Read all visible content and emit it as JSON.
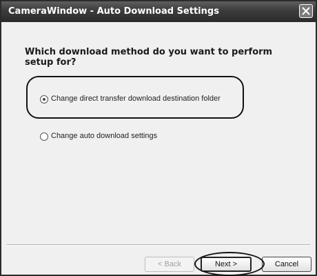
{
  "window": {
    "title": "CameraWindow - Auto Download Settings",
    "close_icon": "close-icon"
  },
  "main": {
    "question": "Which download method do you want to perform setup for?",
    "options": [
      {
        "label": "Change direct transfer download destination folder",
        "selected": true
      },
      {
        "label": "Change auto download settings",
        "selected": false
      }
    ]
  },
  "buttons": {
    "back_label": "< Back",
    "back_enabled": false,
    "next_label": "Next >",
    "cancel_label": "Cancel"
  }
}
